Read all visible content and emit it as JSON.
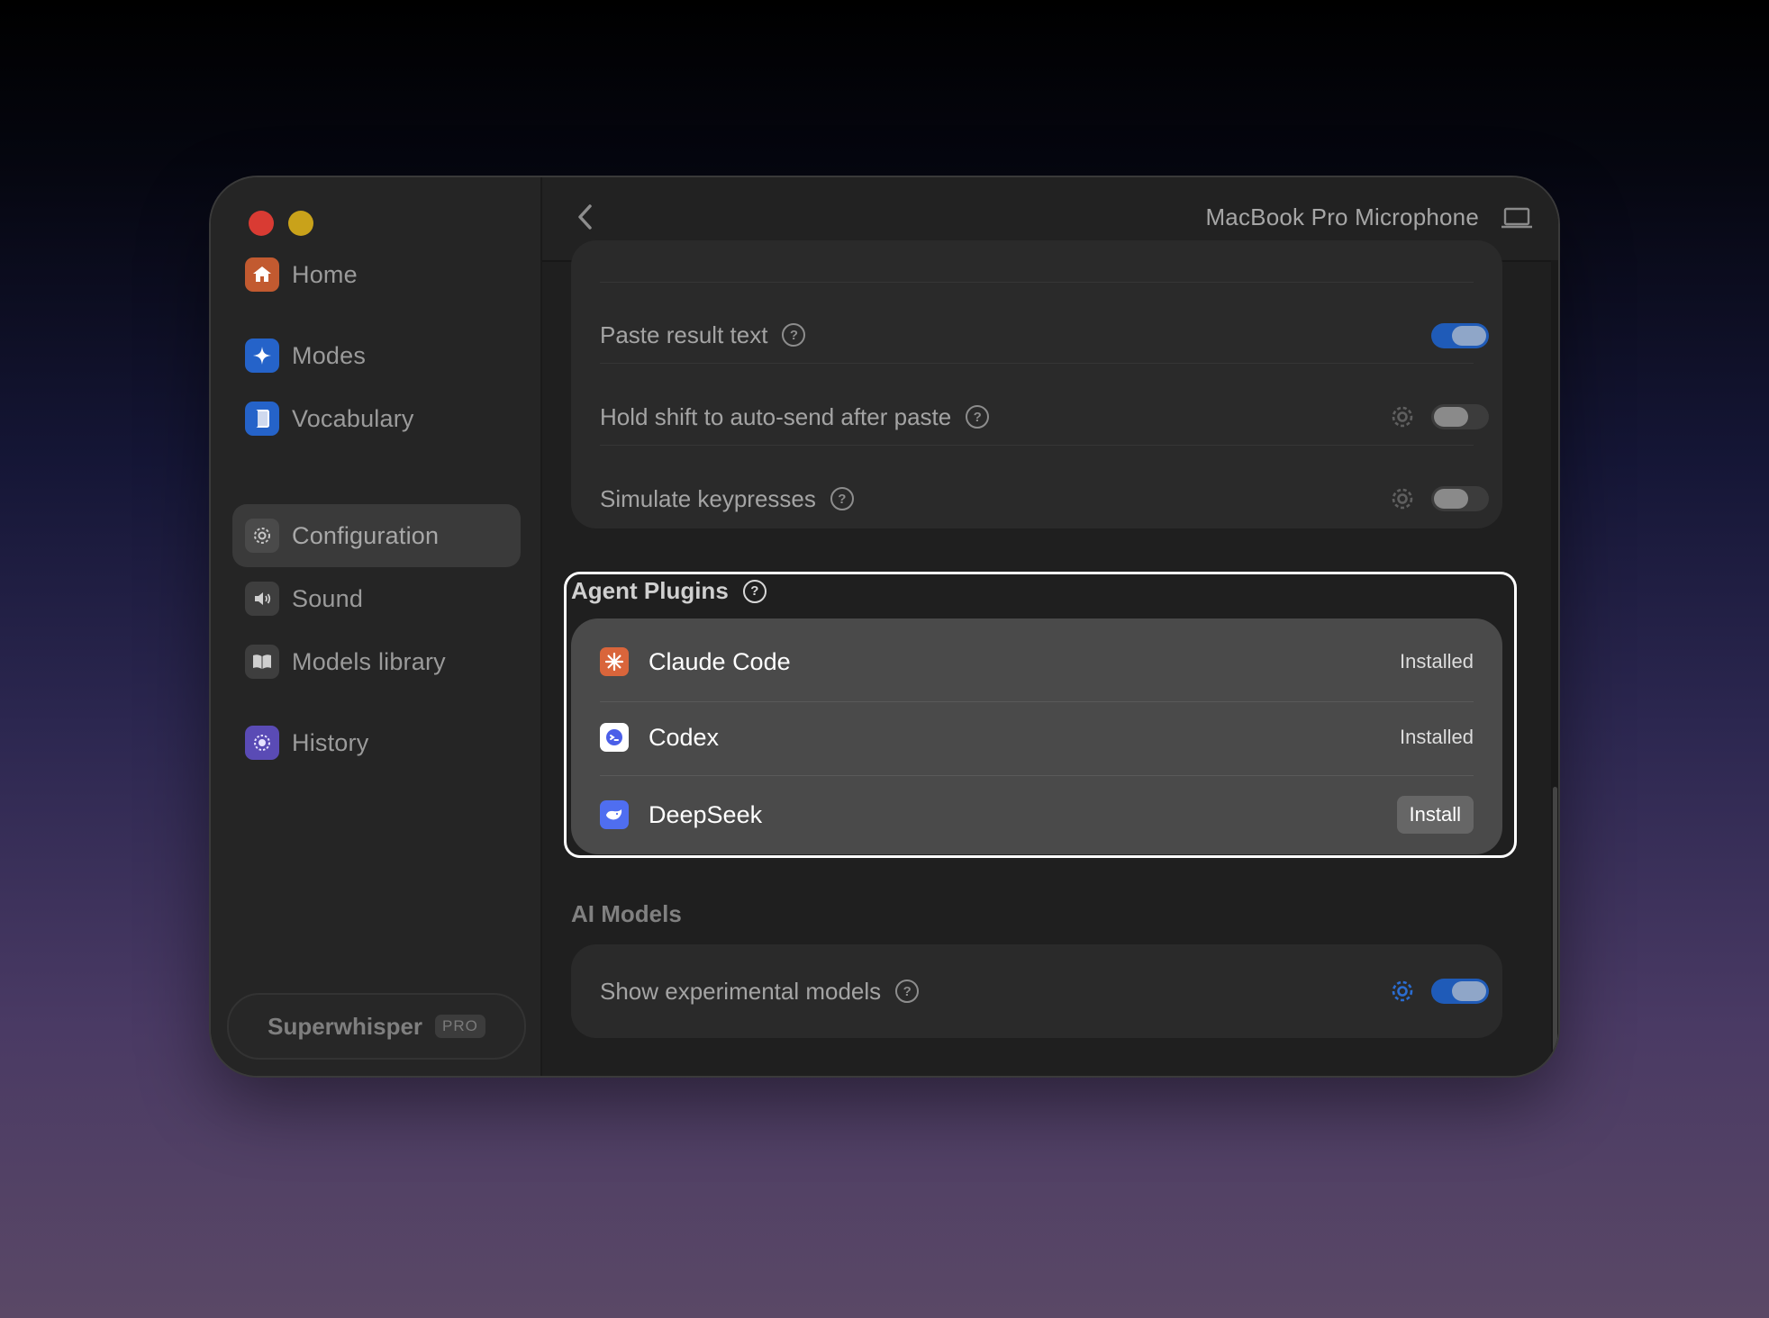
{
  "sidebar": {
    "items": [
      {
        "label": "Home",
        "icon": "home-icon"
      },
      {
        "label": "Modes",
        "icon": "sparkle-icon"
      },
      {
        "label": "Vocabulary",
        "icon": "book-icon"
      },
      {
        "label": "Configuration",
        "icon": "gear-icon",
        "active": true
      },
      {
        "label": "Sound",
        "icon": "speaker-icon"
      },
      {
        "label": "Models library",
        "icon": "open-book-icon"
      },
      {
        "label": "History",
        "icon": "history-icon"
      }
    ],
    "pro_button": {
      "label": "Superwhisper",
      "badge": "PRO"
    }
  },
  "topbar": {
    "microphone": "MacBook Pro Microphone"
  },
  "output_settings": {
    "rows": [
      {
        "label": "Paste result text",
        "toggle": true,
        "has_gear": false
      },
      {
        "label": "Hold shift to auto-send after paste",
        "toggle": false,
        "has_gear": true
      },
      {
        "label": "Simulate keypresses",
        "toggle": false,
        "has_gear": true
      }
    ]
  },
  "agent_plugins": {
    "title": "Agent Plugins",
    "items": [
      {
        "name": "Claude Code",
        "status": "Installed"
      },
      {
        "name": "Codex",
        "status": "Installed"
      },
      {
        "name": "DeepSeek",
        "action": "Install"
      }
    ]
  },
  "ai_models": {
    "title": "AI Models",
    "rows": [
      {
        "label": "Show experimental models",
        "toggle": true,
        "has_gear": true
      }
    ]
  },
  "colors": {
    "accent_blue": "#1f5bb8",
    "close": "#d93b33",
    "minimize": "#c9a21a"
  }
}
